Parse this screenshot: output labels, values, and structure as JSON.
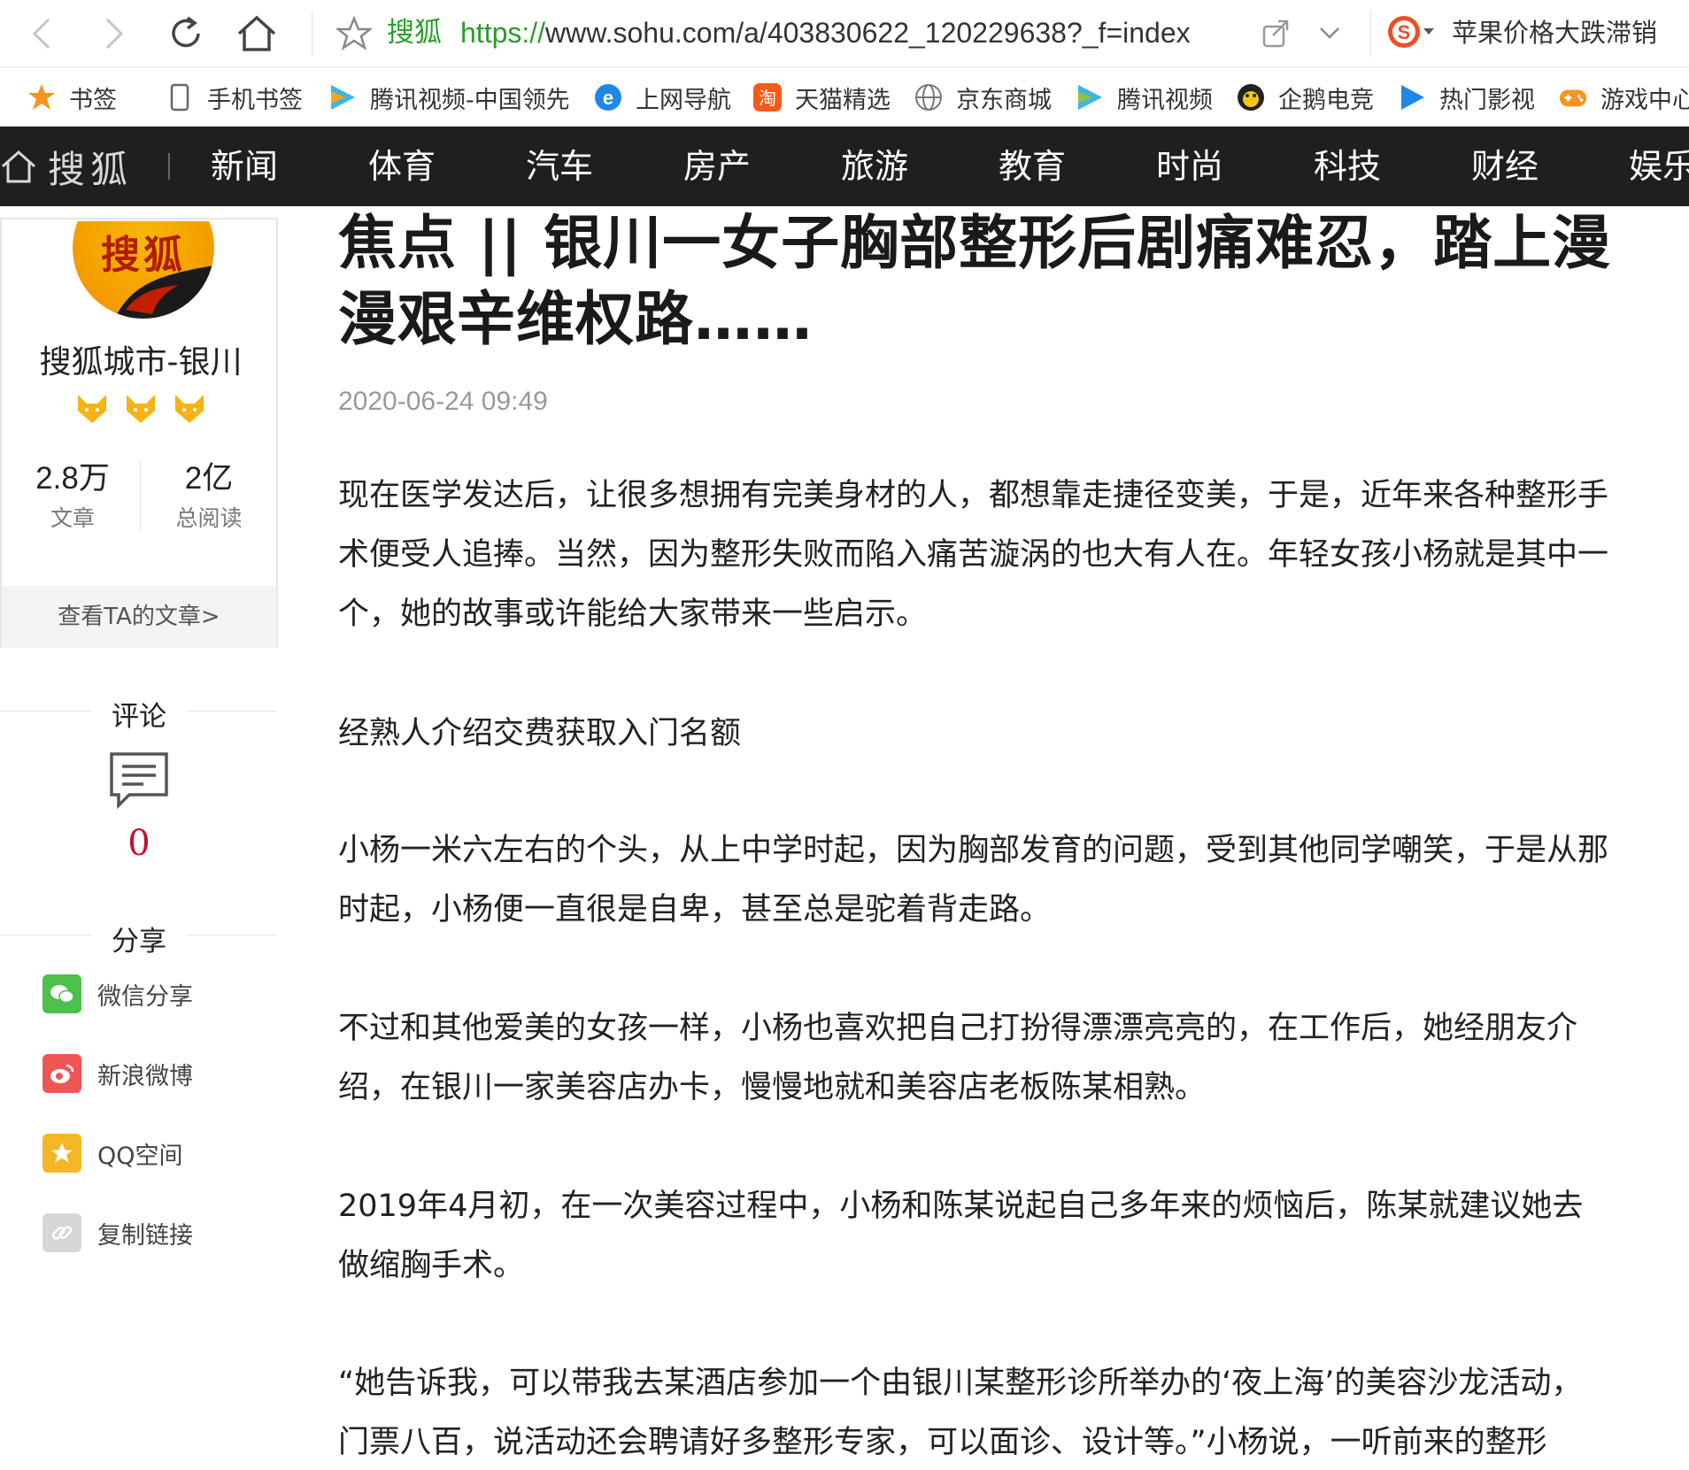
{
  "browser": {
    "site_name": "搜狐",
    "url_scheme": "https://",
    "url_rest": "www.sohu.com/a/403830622_120229638?_f=index",
    "hot_search": "苹果价格大跌滞销"
  },
  "bookmarks": [
    {
      "label": "书签",
      "icon": "star-icon"
    },
    {
      "label": "手机书签",
      "icon": "phone-icon"
    },
    {
      "label": "腾讯视频-中国领先",
      "icon": "tencent-video-icon"
    },
    {
      "label": "上网导航",
      "icon": "ie-icon"
    },
    {
      "label": "天猫精选",
      "icon": "taobao-icon"
    },
    {
      "label": "京东商城",
      "icon": "globe-icon"
    },
    {
      "label": "腾讯视频",
      "icon": "tencent-video-icon"
    },
    {
      "label": "企鹅电竞",
      "icon": "penguin-icon"
    },
    {
      "label": "热门影视",
      "icon": "play-icon"
    },
    {
      "label": "游戏中心",
      "icon": "gamepad-icon"
    }
  ],
  "channel_nav": {
    "logo": "搜狐",
    "items": [
      "新闻",
      "体育",
      "汽车",
      "房产",
      "旅游",
      "教育",
      "时尚",
      "科技",
      "财经",
      "娱乐"
    ]
  },
  "author": {
    "avatar_text": "搜狐",
    "name": "搜狐城市-银川",
    "articles_count": "2.8万",
    "articles_label": "文章",
    "reads_count": "2亿",
    "reads_label": "总阅读",
    "view_link": "查看TA的文章>"
  },
  "comments": {
    "title": "评论",
    "count": "0"
  },
  "share": {
    "title": "分享",
    "items": [
      {
        "label": "微信分享",
        "color": "#4cc04a"
      },
      {
        "label": "新浪微博",
        "color": "#f05555"
      },
      {
        "label": "QQ空间",
        "color": "#f5b624"
      },
      {
        "label": "复制链接",
        "color": "#d6d6d6"
      }
    ]
  },
  "article": {
    "title": "焦点 || 银川一女子胸部整形后剧痛难忍，踏上漫漫艰辛维权路……",
    "date": "2020-06-24 09:49",
    "paragraphs": [
      "现在医学发达后，让很多想拥有完美身材的人，都想靠走捷径变美，于是，近年来各种整形手术便受人追捧。当然，因为整形失败而陷入痛苦漩涡的也大有人在。年轻女孩小杨就是其中一个，她的故事或许能给大家带来一些启示。",
      "经熟人介绍交费获取入门名额",
      "小杨一米六左右的个头，从上中学时起，因为胸部发育的问题，受到其他同学嘲笑，于是从那时起，小杨便一直很是自卑，甚至总是驼着背走路。",
      "不过和其他爱美的女孩一样，小杨也喜欢把自己打扮得漂漂亮亮的，在工作后，她经朋友介绍，在银川一家美容店办卡，慢慢地就和美容店老板陈某相熟。",
      "2019年4月初，在一次美容过程中，小杨和陈某说起自己多年来的烦恼后，陈某就建议她去做缩胸手术。",
      "“她告诉我，可以带我去某酒店参加一个由银川某整形诊所举办的‘夜上海’的美容沙龙活动，门票八百，说活动还会聘请好多整形专家，可以面诊、设计等。”小杨说，一听前来的整形"
    ]
  }
}
